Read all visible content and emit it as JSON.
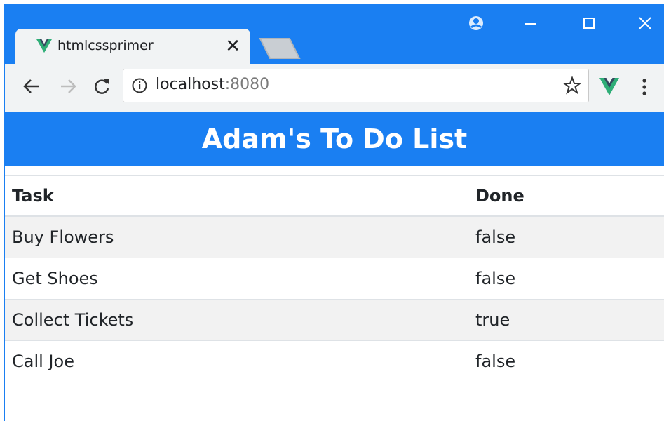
{
  "browser": {
    "tab_title": "htmlcssprimer",
    "tab_close": "✕",
    "url_host": "localhost",
    "url_port": ":8080"
  },
  "page": {
    "heading": "Adam's To Do List",
    "table": {
      "headers": [
        "Task",
        "Done"
      ],
      "rows": [
        [
          "Buy Flowers",
          "false"
        ],
        [
          "Get Shoes",
          "false"
        ],
        [
          "Collect Tickets",
          "true"
        ],
        [
          "Call Joe",
          "false"
        ]
      ]
    }
  },
  "colors": {
    "accent": "#1a7ff2",
    "vue_green": "#2fae77",
    "vue_dark": "#35495e"
  }
}
